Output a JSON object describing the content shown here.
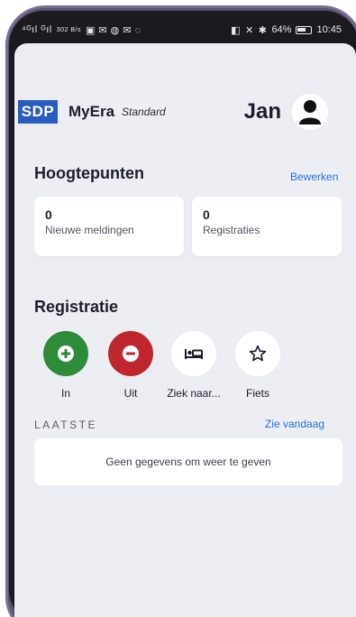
{
  "status_bar": {
    "left_signals": "⁴ᴳıl ᴳıl",
    "data_rate": "302 B/s",
    "battery": "64%",
    "time": "10:45"
  },
  "header": {
    "logo_text": "SDP",
    "app_name": "MyEra",
    "edition": "Standard",
    "user_name": "Jan"
  },
  "highlights": {
    "title": "Hoogtepunten",
    "edit_link": "Bewerken",
    "cards": [
      {
        "value": "0",
        "label": "Nieuwe meldingen"
      },
      {
        "value": "0",
        "label": "Registraties"
      }
    ]
  },
  "registration": {
    "title": "Registratie",
    "actions": [
      {
        "label": "In",
        "icon": "plus-circle-icon",
        "color": "#2e8b3a"
      },
      {
        "label": "Uit",
        "icon": "minus-circle-icon",
        "color": "#c0262d"
      },
      {
        "label": "Ziek naar...",
        "icon": "bed-icon",
        "color": "#ffffff"
      },
      {
        "label": "Fiets",
        "icon": "star-icon",
        "color": "#ffffff"
      }
    ]
  },
  "latest": {
    "title": "LAATSTE",
    "today_link": "Zie vandaag",
    "empty_message": "Geen gegevens om weer te geven"
  },
  "colors": {
    "brand_blue": "#2a5bbf",
    "link_blue": "#2a6fd6",
    "background": "#eceef3"
  }
}
